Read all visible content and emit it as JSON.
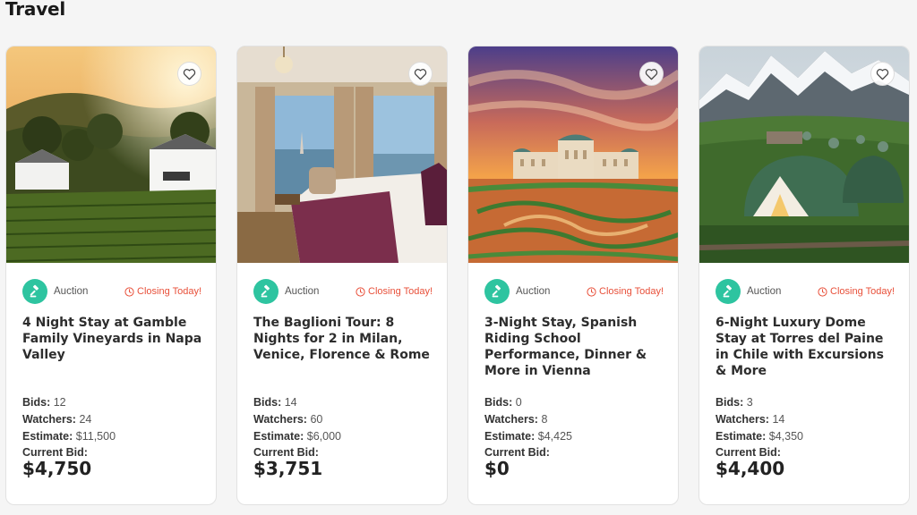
{
  "section": {
    "title": "Travel"
  },
  "labels": {
    "auction": "Auction",
    "closing": "Closing Today!",
    "bids": "Bids:",
    "watchers": "Watchers:",
    "estimate": "Estimate:",
    "current_bid": "Current Bid:"
  },
  "colors": {
    "accent_green": "#2ec4a0",
    "closing_red": "#e8503a"
  },
  "cards": [
    {
      "title": "4 Night Stay at Gamble Family Vineyards in Napa Valley",
      "bids": "12",
      "watchers": "24",
      "estimate": "$11,500",
      "current_bid": "$4,750",
      "image": "vineyard-photo"
    },
    {
      "title": "The Baglioni Tour: 8 Nights for 2 in Milan, Venice, Florence & Rome",
      "bids": "14",
      "watchers": "60",
      "estimate": "$6,000",
      "current_bid": "$3,751",
      "image": "hotel-room-photo"
    },
    {
      "title": "3-Night Stay, Spanish Riding School Performance, Dinner & More in Vienna",
      "bids": "0",
      "watchers": "8",
      "estimate": "$4,425",
      "current_bid": "$0",
      "image": "vienna-palace-photo"
    },
    {
      "title": "6-Night Luxury Dome Stay at Torres del Paine in Chile with Excursions & More",
      "bids": "3",
      "watchers": "14",
      "estimate": "$4,350",
      "current_bid": "$4,400",
      "image": "patagonia-dome-photo"
    }
  ]
}
